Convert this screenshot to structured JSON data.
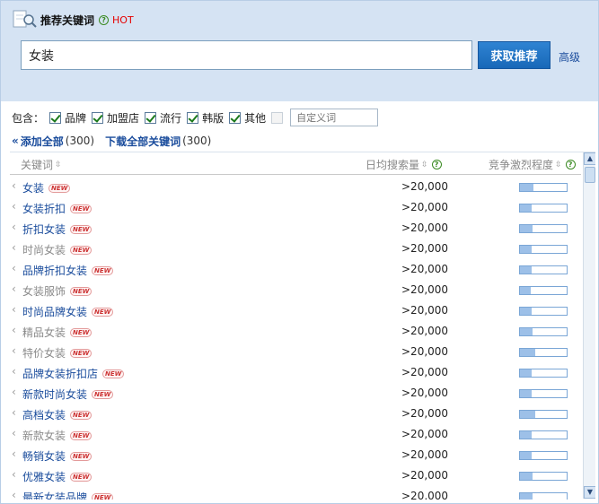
{
  "header": {
    "title": "推荐关键词",
    "help_icon": "?",
    "hot_label": "HOT"
  },
  "search": {
    "value": "女装",
    "button": "获取推荐",
    "advanced": "高级"
  },
  "filters": {
    "label": "包含：",
    "options": [
      {
        "label": "品牌",
        "checked": true
      },
      {
        "label": "加盟店",
        "checked": true
      },
      {
        "label": "流行",
        "checked": true
      },
      {
        "label": "韩版",
        "checked": true
      },
      {
        "label": "其他",
        "checked": true
      }
    ],
    "custom_checked": false,
    "custom_placeholder": "自定义词"
  },
  "actions": {
    "add_all_label": "添加全部",
    "add_all_count": "(300)",
    "download_label": "下载全部关键词",
    "download_count": "(300)"
  },
  "table": {
    "columns": [
      "关键词",
      "日均搜索量",
      "竞争激烈程度"
    ],
    "sort_icon": "up-down-sort-icon",
    "new_badge": "NEW",
    "rows": [
      {
        "keyword": "女装",
        "grey": false,
        "volume": ">20,000",
        "competition": 0.28
      },
      {
        "keyword": "女装折扣",
        "grey": false,
        "volume": ">20,000",
        "competition": 0.25
      },
      {
        "keyword": "折扣女装",
        "grey": false,
        "volume": ">20,000",
        "competition": 0.26
      },
      {
        "keyword": "时尚女装",
        "grey": true,
        "volume": ">20,000",
        "competition": 0.25
      },
      {
        "keyword": "品牌折扣女装",
        "grey": false,
        "volume": ">20,000",
        "competition": 0.25
      },
      {
        "keyword": "女装服饰",
        "grey": true,
        "volume": ">20,000",
        "competition": 0.23
      },
      {
        "keyword": "时尚品牌女装",
        "grey": false,
        "volume": ">20,000",
        "competition": 0.25
      },
      {
        "keyword": "精品女装",
        "grey": true,
        "volume": ">20,000",
        "competition": 0.26
      },
      {
        "keyword": "特价女装",
        "grey": true,
        "volume": ">20,000",
        "competition": 0.32
      },
      {
        "keyword": "品牌女装折扣店",
        "grey": false,
        "volume": ">20,000",
        "competition": 0.25
      },
      {
        "keyword": "新款时尚女装",
        "grey": false,
        "volume": ">20,000",
        "competition": 0.25
      },
      {
        "keyword": "高档女装",
        "grey": false,
        "volume": ">20,000",
        "competition": 0.32
      },
      {
        "keyword": "新款女装",
        "grey": true,
        "volume": ">20,000",
        "competition": 0.25
      },
      {
        "keyword": "畅销女装",
        "grey": false,
        "volume": ">20,000",
        "competition": 0.25
      },
      {
        "keyword": "优雅女装",
        "grey": false,
        "volume": ">20,000",
        "competition": 0.27
      },
      {
        "keyword": "最新女装品牌",
        "grey": false,
        "volume": ">20,000",
        "competition": 0.27
      }
    ]
  },
  "colors": {
    "header_bg": "#d5e3f3",
    "accent": "#1a6bbf",
    "link": "#1a4c9c",
    "hot": "#e60000",
    "bar_fill": "#9dc0e8"
  }
}
